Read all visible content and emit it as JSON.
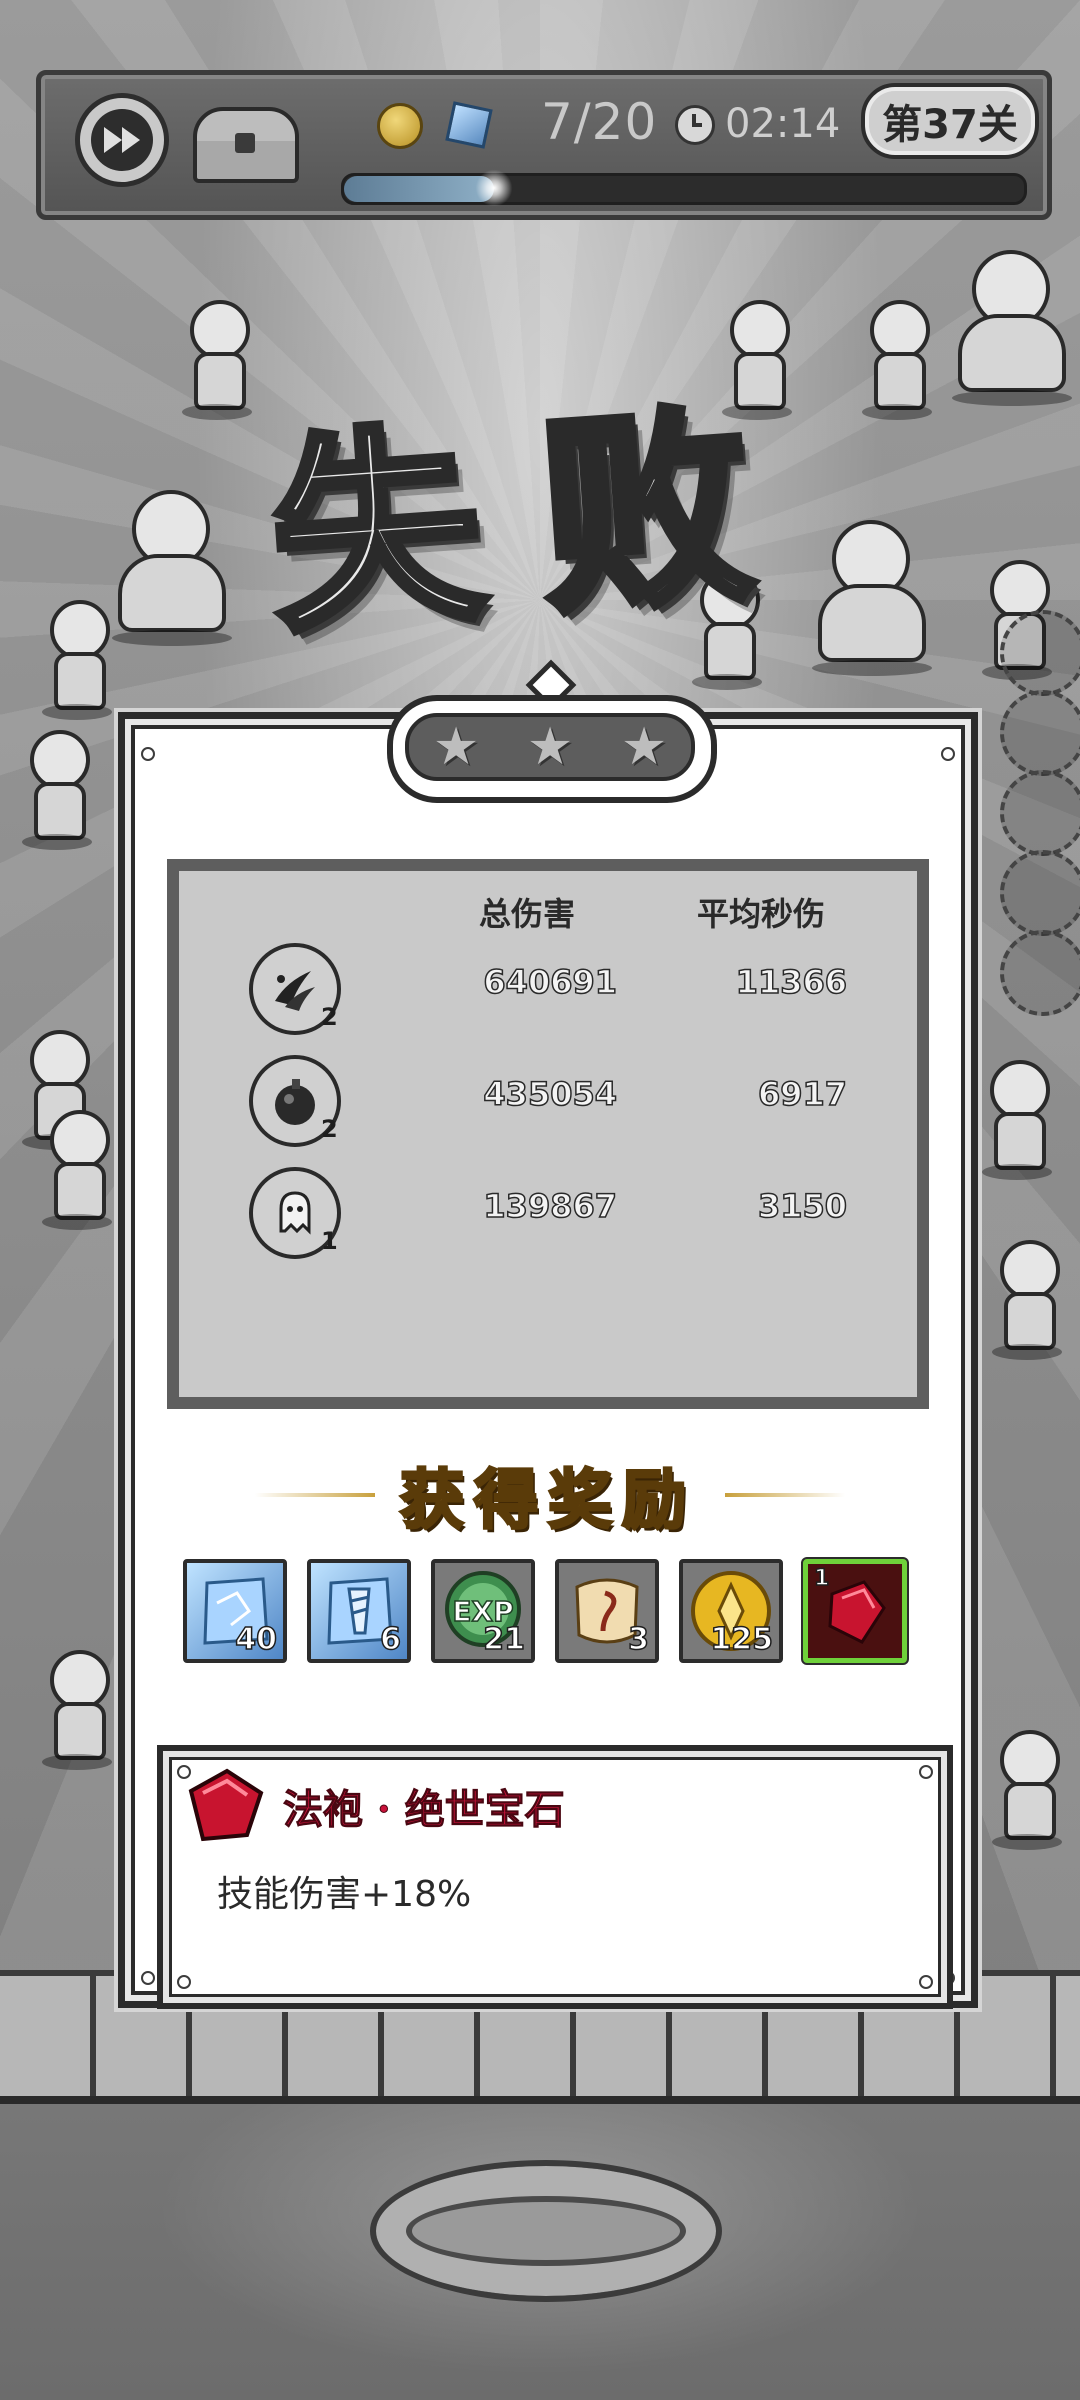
{
  "hud": {
    "wave_text": "7/20",
    "time_text": "02:14",
    "level_text": "第37关",
    "progress": 0.22
  },
  "result": {
    "title": "失败",
    "stars_earned": 0,
    "stars_total": 3
  },
  "stats": {
    "header_total": "总伤害",
    "header_dps": "平均秒伤",
    "rows": [
      {
        "icon": "dark-claw-skill-icon",
        "level": "2",
        "total": "640691",
        "dps": "11366"
      },
      {
        "icon": "bomb-skill-icon",
        "level": "2",
        "total": "435054",
        "dps": "6917"
      },
      {
        "icon": "ghost-skill-icon",
        "level": "1",
        "total": "139867",
        "dps": "3150"
      }
    ]
  },
  "rewards": {
    "title": "获得奖励",
    "items": [
      {
        "icon": "blue-crystal-icon",
        "count": "40"
      },
      {
        "icon": "blue-drill-crystal-icon",
        "count": "6"
      },
      {
        "icon": "exp-orb-icon",
        "count": "21"
      },
      {
        "icon": "scroll-icon",
        "count": "3"
      },
      {
        "icon": "gold-coin-icon",
        "count": "125"
      },
      {
        "icon": "red-gem-icon",
        "count": "1"
      }
    ]
  },
  "detail": {
    "name": "法袍 · 绝世宝石",
    "effect": "技能伤害+18%"
  },
  "colors": {
    "reward_title": "#f3c74b",
    "detail_title": "#c8123a",
    "selected_border": "#6fd13a"
  }
}
